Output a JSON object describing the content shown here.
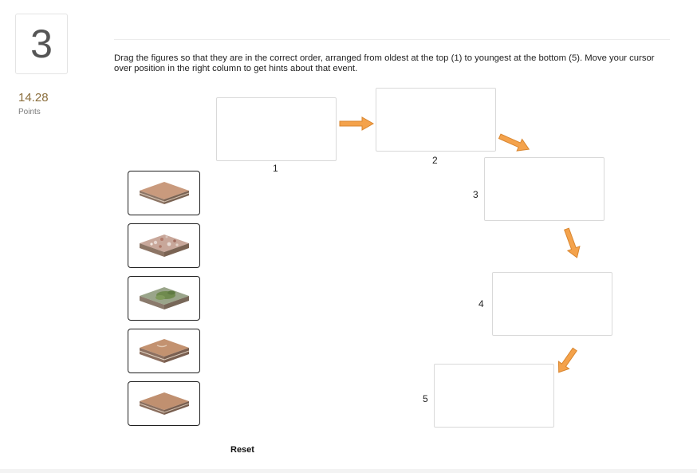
{
  "question": {
    "number": "3",
    "points_value": "14.28",
    "points_label": "Points"
  },
  "instructions": "Drag the figures so that they are in the correct order, arranged from oldest at the top (1) to youngest at the bottom (5). Move your cursor over position in the right column to get hints about that event.",
  "tiles": [
    {
      "icon": "rock-layer-block-icon",
      "top_color": "#c99a7d",
      "band_color": "#bfa08a"
    },
    {
      "icon": "rock-layer-rubble-block-icon",
      "top_color": "#c8a79a",
      "band_color": "#b89a86"
    },
    {
      "icon": "rock-layer-vegetation-block-icon",
      "top_color": "#8e9a74",
      "band_color": "#a99a8a"
    },
    {
      "icon": "rock-layer-eroded-block-icon",
      "top_color": "#c39270",
      "band_color": "#b78f74"
    },
    {
      "icon": "rock-layer-plain-block-icon",
      "top_color": "#c09070",
      "band_color": "#b48e74"
    }
  ],
  "slots": [
    {
      "label": "1"
    },
    {
      "label": "2"
    },
    {
      "label": "3"
    },
    {
      "label": "4"
    },
    {
      "label": "5"
    }
  ],
  "colors": {
    "arrow_fill": "#f4a24b",
    "arrow_stroke": "#d9862f",
    "points_accent": "#8a6d3b"
  },
  "controls": {
    "reset_label": "Reset"
  }
}
